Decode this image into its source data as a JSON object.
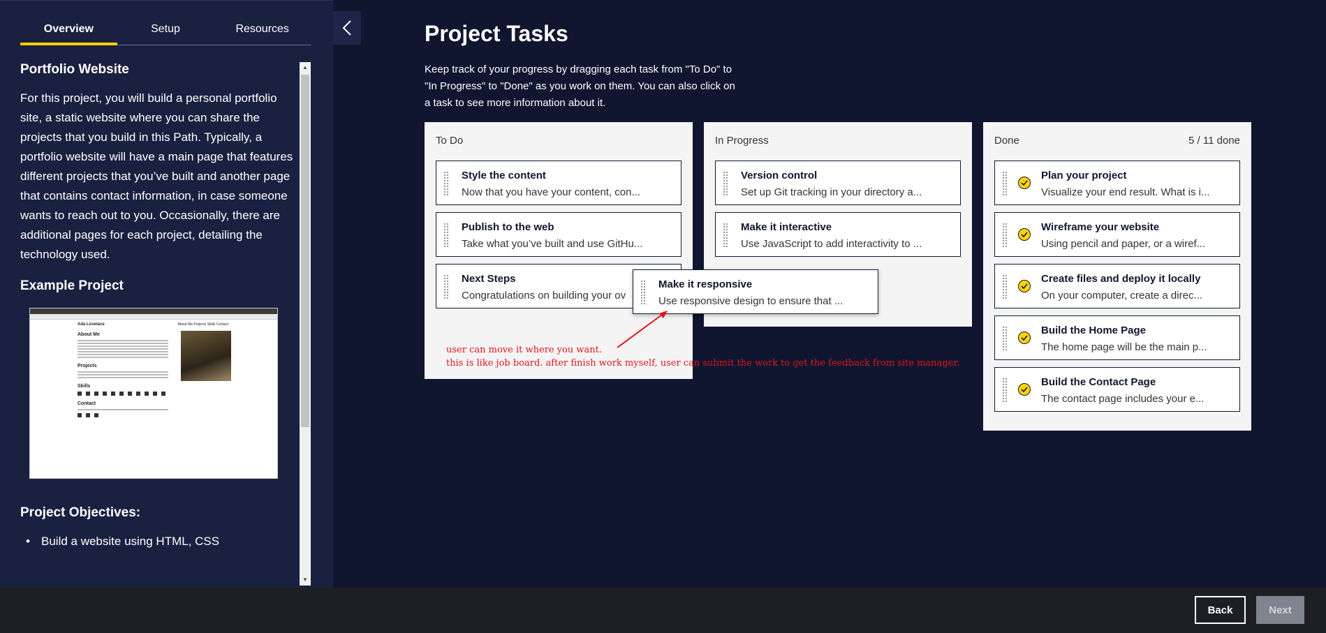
{
  "tabs": [
    "Overview",
    "Setup",
    "Resources"
  ],
  "sidebar": {
    "section_title": "Portfolio Website",
    "description": "For this project, you will build a personal portfolio site, a static website where you can share the projects that you build in this Path. Typically, a portfolio website will have a main page that features different projects that you’ve built and another page that contains contact information, in case someone wants to reach out to you. Occasionally, there are additional pages for each project, detailing the technology used.",
    "example_title": "Example Project",
    "example_image": {
      "name": "Ada Lovelace",
      "nav": "About Me   Projects   Skills   Contact",
      "about": "About Me",
      "projects": "Projects",
      "skills": "Skills",
      "contact": "Contact"
    },
    "objectives_title": "Project Objectives:",
    "objective_1": "Build a website using HTML, CSS"
  },
  "main": {
    "title": "Project Tasks",
    "description": "Keep track of your progress by dragging each task from \"To Do\" to \"In Progress\" to \"Done\" as you work on them. You can also click on a task to see more information about it."
  },
  "board": {
    "todo": {
      "label": "To Do",
      "cards": [
        {
          "title": "Style the content",
          "desc": "Now that you have your content, con..."
        },
        {
          "title": "Publish to the web",
          "desc": "Take what you’ve built and use GitHu..."
        },
        {
          "title": "Next Steps",
          "desc": "Congratulations on building your ov"
        }
      ]
    },
    "in_progress": {
      "label": "In Progress",
      "cards": [
        {
          "title": "Version control",
          "desc": "Set up Git tracking in your directory a..."
        },
        {
          "title": "Make it interactive",
          "desc": "Use JavaScript to add interactivity to ..."
        }
      ]
    },
    "done": {
      "label": "Done",
      "count": "5 / 11 done",
      "cards": [
        {
          "title": "Plan your project",
          "desc": "Visualize your end result. What is i..."
        },
        {
          "title": "Wireframe your website",
          "desc": "Using pencil and paper, or a wiref..."
        },
        {
          "title": "Create files and deploy it locally",
          "desc": "On your computer, create a direc..."
        },
        {
          "title": "Build the Home Page",
          "desc": "The home page will be the main p..."
        },
        {
          "title": "Build the Contact Page",
          "desc": "The contact page includes your e..."
        }
      ]
    },
    "dragging": {
      "title": "Make it responsive",
      "desc": "Use responsive design to ensure that ..."
    }
  },
  "annotation": {
    "line1": "user can move it where you want.",
    "line2": "this is like job board. after finish work myself, user can submit the work to get the feedback from site manager."
  },
  "footer": {
    "back": "Back",
    "next": "Next"
  },
  "colors": {
    "accent": "#ffd300",
    "background": "#10162f",
    "annotation": "#e0141e"
  }
}
